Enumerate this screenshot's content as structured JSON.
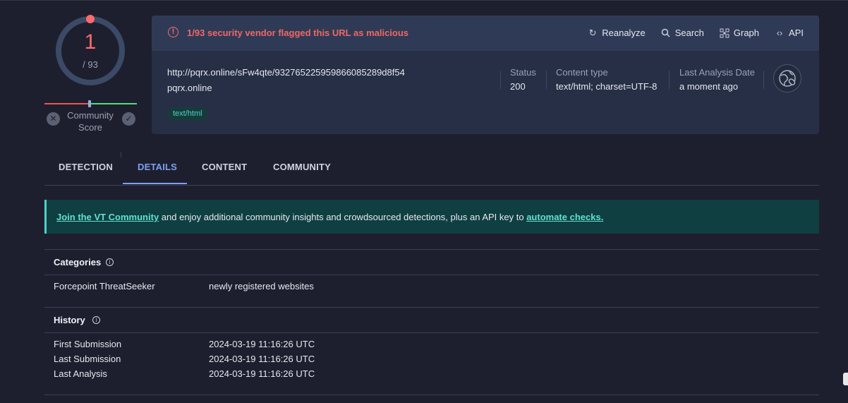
{
  "score": {
    "detections": "1",
    "total": "/ 93",
    "detection_ratio": 0.0108
  },
  "community": {
    "label": "Community Score",
    "downvote_icon": "x-icon",
    "upvote_icon": "check-icon"
  },
  "alert": {
    "text": "1/93 security vendor flagged this URL as malicious",
    "color": "#f06767"
  },
  "actions": [
    {
      "label": "Reanalyze",
      "icon": "refresh-icon"
    },
    {
      "label": "Search",
      "icon": "search-icon"
    },
    {
      "label": "Graph",
      "icon": "graph-icon"
    },
    {
      "label": "API",
      "icon": "api-icon"
    }
  ],
  "target": {
    "url": "http://pqrx.online/sFw4qte/93276522595986608528​9d8f54",
    "domain": "pqrx.online",
    "tag": "text/html"
  },
  "meta": [
    {
      "key": "Status",
      "value": "200"
    },
    {
      "key": "Content type",
      "value": "text/html; charset=UTF-8"
    },
    {
      "key": "Last Analysis Date",
      "value": "a moment ago"
    }
  ],
  "tabs": [
    {
      "label": "DETECTION",
      "active": false
    },
    {
      "label": "DETAILS",
      "active": true
    },
    {
      "label": "CONTENT",
      "active": false
    },
    {
      "label": "COMMUNITY",
      "active": false
    }
  ],
  "banner": {
    "link1": "Join the VT Community",
    "middle": " and enjoy additional community insights and crowdsourced detections, plus an API key to ",
    "link2": "automate checks."
  },
  "categories": {
    "title": "Categories",
    "rows": [
      {
        "key": "Forcepoint ThreatSeeker",
        "value": "newly registered websites"
      }
    ]
  },
  "history": {
    "title": "History",
    "rows": [
      {
        "key": "First Submission",
        "value": "2024-03-19 11:16:26 UTC"
      },
      {
        "key": "Last Submission",
        "value": "2024-03-19 11:16:26 UTC"
      },
      {
        "key": "Last Analysis",
        "value": "2024-03-19 11:16:26 UTC"
      }
    ]
  },
  "colors": {
    "background": "#1e1f2e",
    "card": "#262f45",
    "accent": "#7da0f0",
    "malicious": "#ff6b6b",
    "teal": "#4fd1c5"
  }
}
